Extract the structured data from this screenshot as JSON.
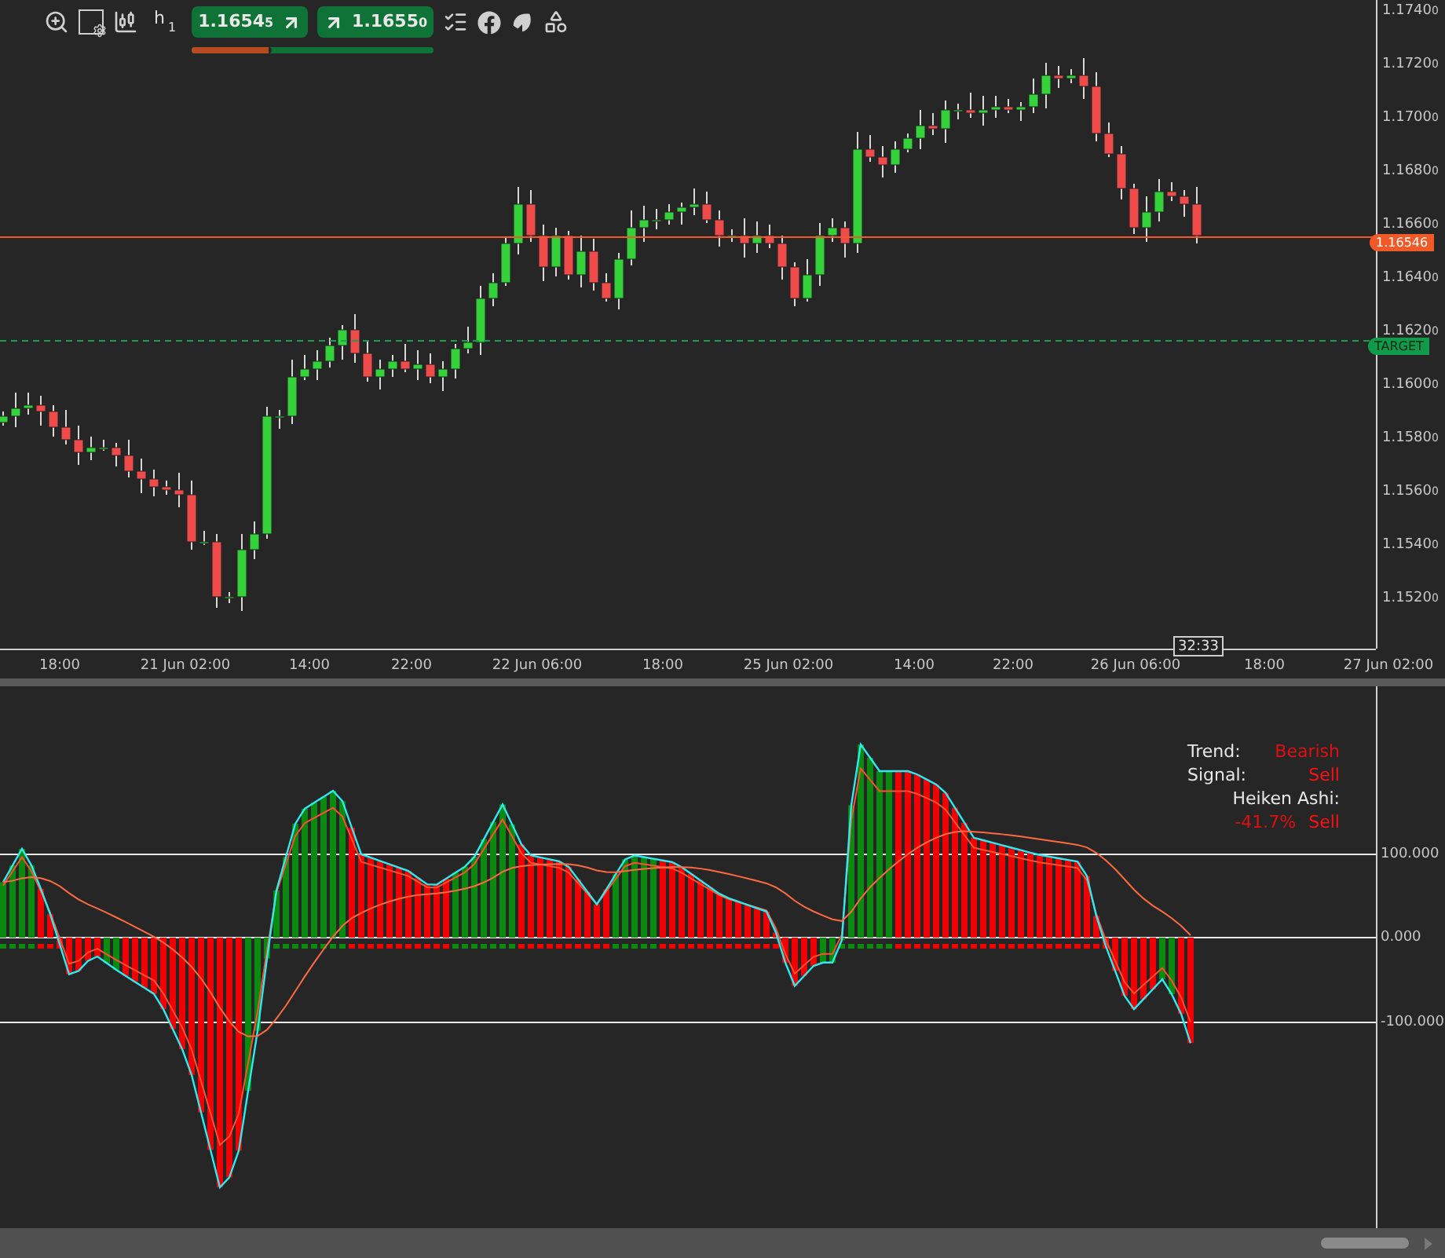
{
  "toolbar": {
    "timeframe": {
      "unit": "h",
      "count": "1"
    }
  },
  "quotes": [
    {
      "kind": "sell",
      "price": "1.1654",
      "pip": "5"
    },
    {
      "kind": "buy",
      "price": "1.1655",
      "pip": "0"
    }
  ],
  "sentiment": {
    "level": 0.33
  },
  "price_axis": [
    "1.17400",
    "1.17200",
    "1.17000",
    "1.16800",
    "1.16600",
    "1.16400",
    "1.16200",
    "1.16000",
    "1.15800",
    "1.15600",
    "1.15400",
    "1.15200"
  ],
  "price_tag": "1.16546",
  "target_tag": "TARGET",
  "time_axis": [
    "18:00",
    "21 Jun 02:00",
    "14:00",
    "22:00",
    "22 Jun 06:00",
    "18:00",
    "25 Jun 02:00",
    "14:00",
    "22:00",
    "26 Jun 06:00",
    "18:00",
    "27 Jun 02:00"
  ],
  "timer": "32:33",
  "indicator": {
    "levels": [
      "100.000",
      "0.000",
      "-100.000"
    ],
    "trend_label": "Trend:",
    "trend": "Bearish",
    "signal_label": "Signal:",
    "signal": "Sell",
    "heiken_label": "Heiken Ashi:",
    "heiken_value": "-41.7%",
    "heiken_signal": "Sell"
  }
}
